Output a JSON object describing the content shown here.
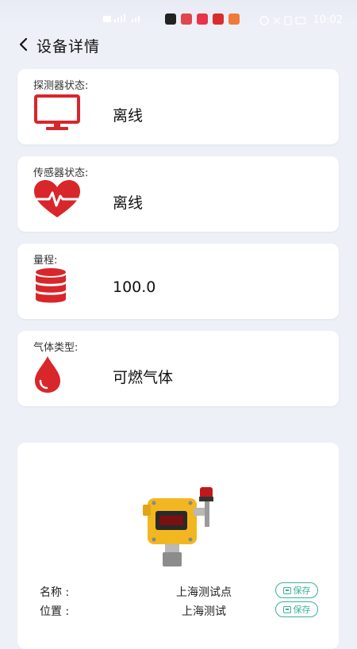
{
  "status_bar": {
    "time": "10:02"
  },
  "header": {
    "title": "设备详情"
  },
  "cards": [
    {
      "label": "探测器状态:",
      "value": "离线",
      "icon": "monitor-icon"
    },
    {
      "label": "传感器状态:",
      "value": "离线",
      "icon": "heart-pulse-icon"
    },
    {
      "label": "量程:",
      "value": "100.0",
      "icon": "database-icon"
    },
    {
      "label": "气体类型:",
      "value": "可燃气体",
      "icon": "drop-icon"
    }
  ],
  "device": {
    "name_label": "名称 :",
    "name_value": "上海测试点",
    "location_label": "位置 :",
    "location_value": "上海测试",
    "save_label": "保存"
  },
  "colors": {
    "accent_red": "#d8262b",
    "save_green": "#39b29a",
    "background": "#eef0f8"
  }
}
